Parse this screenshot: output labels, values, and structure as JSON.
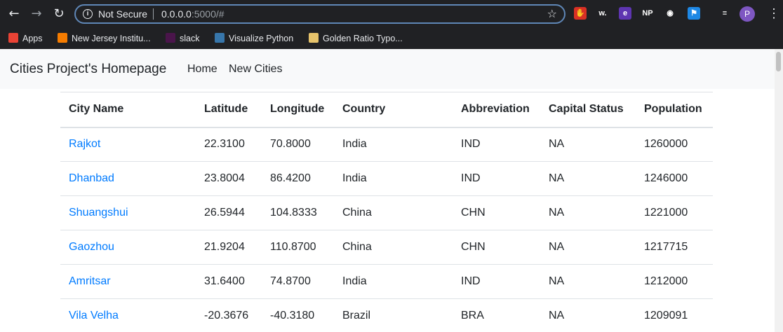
{
  "browser": {
    "security_label": "Not Secure",
    "url_host": "0.0.0.0",
    "url_rest": ":5000/#",
    "bookmarks": [
      {
        "label": "Apps",
        "icon": "apps-grid-icon",
        "color": "#ea4335"
      },
      {
        "label": "New Jersey Institu...",
        "icon": "njit-icon",
        "color": "#f57c00"
      },
      {
        "label": "slack",
        "icon": "slack-icon",
        "color": "#4a154b"
      },
      {
        "label": "Visualize Python",
        "icon": "python-icon",
        "color": "#3776ab"
      },
      {
        "label": "Golden Ratio Typo...",
        "icon": "golden-ratio-icon",
        "color": "#e6c36b"
      }
    ],
    "extensions": [
      {
        "name": "adblock-icon",
        "text": "✋",
        "color": "#d93025"
      },
      {
        "name": "w-extension-icon",
        "text": "w.",
        "color": "#202124"
      },
      {
        "name": "e-extension-icon",
        "text": "e",
        "color": "#5e35b1"
      },
      {
        "name": "np-extension-icon",
        "text": "NP",
        "color": "#202124"
      },
      {
        "name": "record-extension-icon",
        "text": "◉",
        "color": "#202124"
      },
      {
        "name": "puzzle-extension-icon",
        "text": "⚑",
        "color": "#1e88e5"
      },
      {
        "name": "media-controls-icon",
        "text": "≡",
        "color": "#202124"
      }
    ],
    "avatar_letter": "P"
  },
  "navbar": {
    "brand": "Cities Project's Homepage",
    "links": [
      "Home",
      "New Cities"
    ]
  },
  "table": {
    "headers": [
      "City Name",
      "Latitude",
      "Longitude",
      "Country",
      "Abbreviation",
      "Capital Status",
      "Population"
    ],
    "rows": [
      [
        "Rajkot",
        "22.3100",
        "70.8000",
        "India",
        "IND",
        "NA",
        "1260000"
      ],
      [
        "Dhanbad",
        "23.8004",
        "86.4200",
        "India",
        "IND",
        "NA",
        "1246000"
      ],
      [
        "Shuangshui",
        "26.5944",
        "104.8333",
        "China",
        "CHN",
        "NA",
        "1221000"
      ],
      [
        "Gaozhou",
        "21.9204",
        "110.8700",
        "China",
        "CHN",
        "NA",
        "1217715"
      ],
      [
        "Amritsar",
        "31.6400",
        "74.8700",
        "India",
        "IND",
        "NA",
        "1212000"
      ],
      [
        "Vila Velha",
        "-20.3676",
        "-40.3180",
        "Brazil",
        "BRA",
        "NA",
        "1209091"
      ]
    ]
  },
  "colors": {
    "link": "#007bff",
    "chrome_bg": "#202124",
    "navbar_bg": "#f8f9fa"
  }
}
